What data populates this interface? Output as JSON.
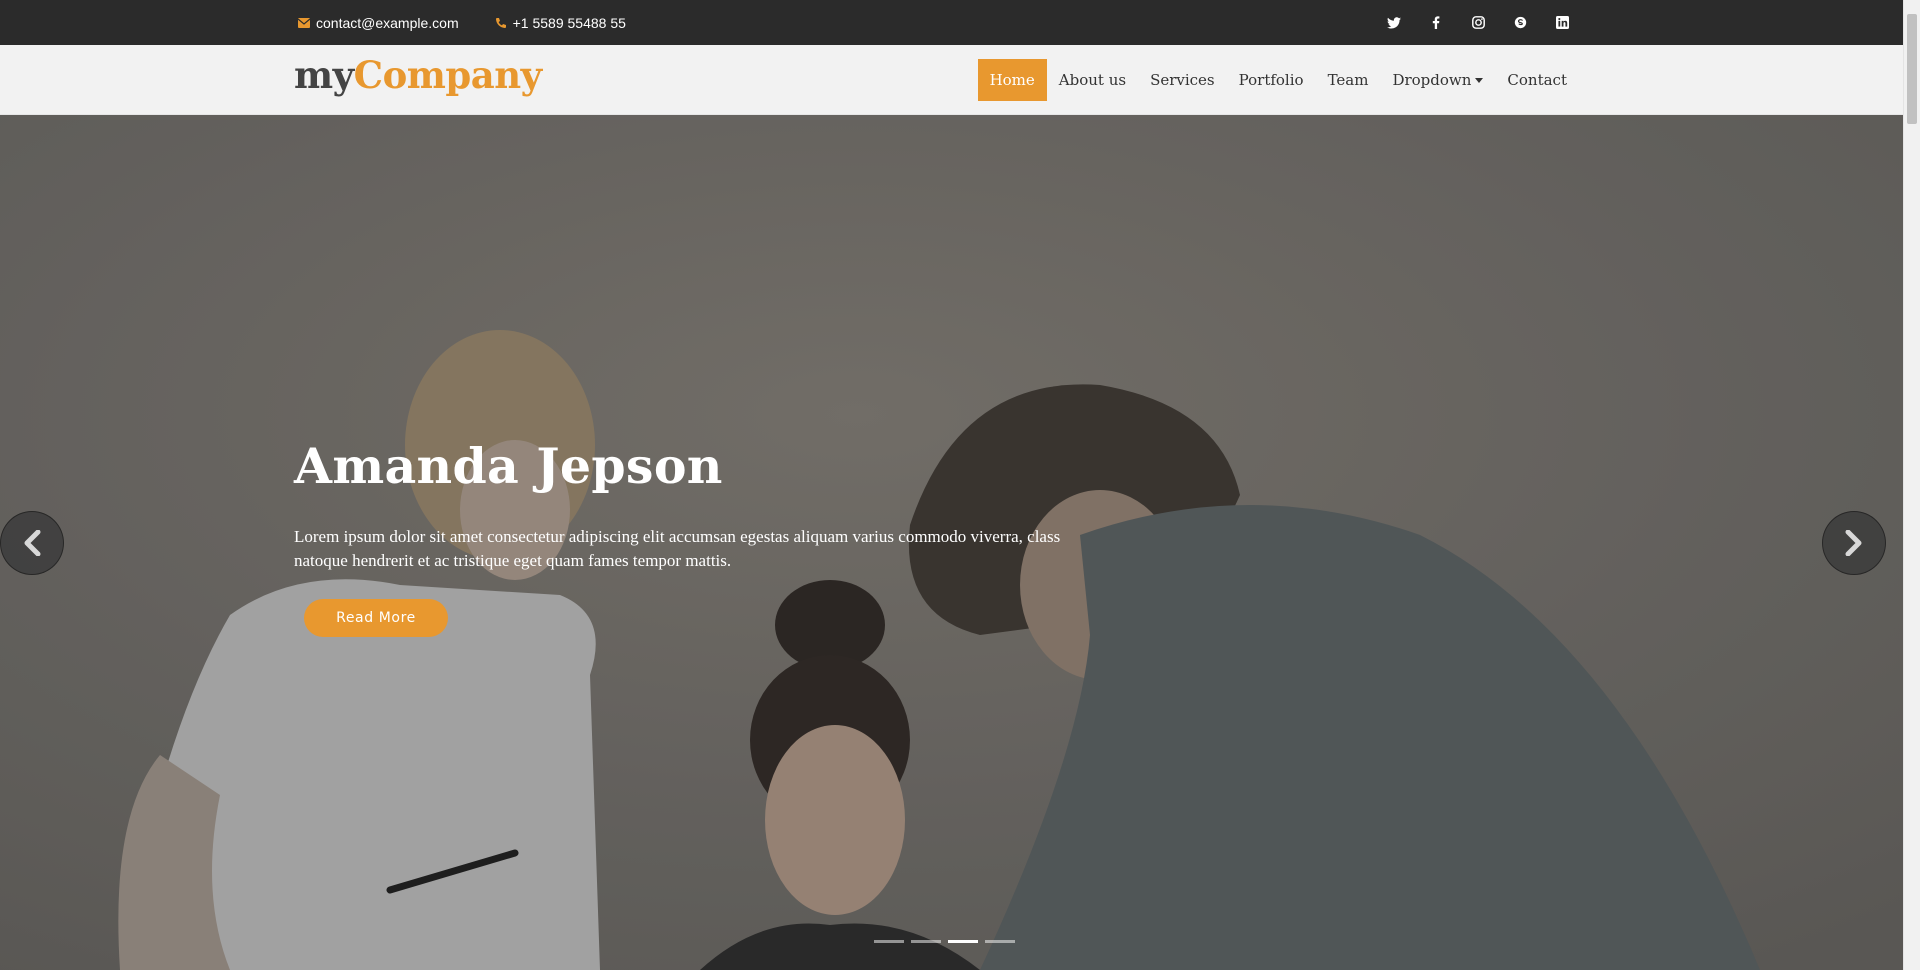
{
  "topbar": {
    "email": "contact@example.com",
    "phone": "+1 5589 55488 55",
    "social": [
      "twitter-icon",
      "facebook-icon",
      "instagram-icon",
      "skype-icon",
      "linkedin-icon"
    ]
  },
  "header": {
    "logo_my": "my",
    "logo_company": "Company",
    "nav": [
      {
        "label": "Home",
        "active": true
      },
      {
        "label": "About us"
      },
      {
        "label": "Services"
      },
      {
        "label": "Portfolio"
      },
      {
        "label": "Team"
      },
      {
        "label": "Dropdown"
      },
      {
        "label": "Contact"
      }
    ]
  },
  "hero": {
    "title": "Amanda Jepson",
    "text": "Lorem ipsum dolor sit amet consectetur adipiscing elit accumsan egestas aliquam varius commodo viverra, class natoque hendrerit et ac tristique eget quam fames tempor mattis.",
    "button": "Read More",
    "indicators_count": 4,
    "active_indicator": 3
  },
  "colors": {
    "accent": "#e8982f",
    "topbar_bg": "#2b2b2b",
    "header_bg": "#f2f2f2"
  }
}
